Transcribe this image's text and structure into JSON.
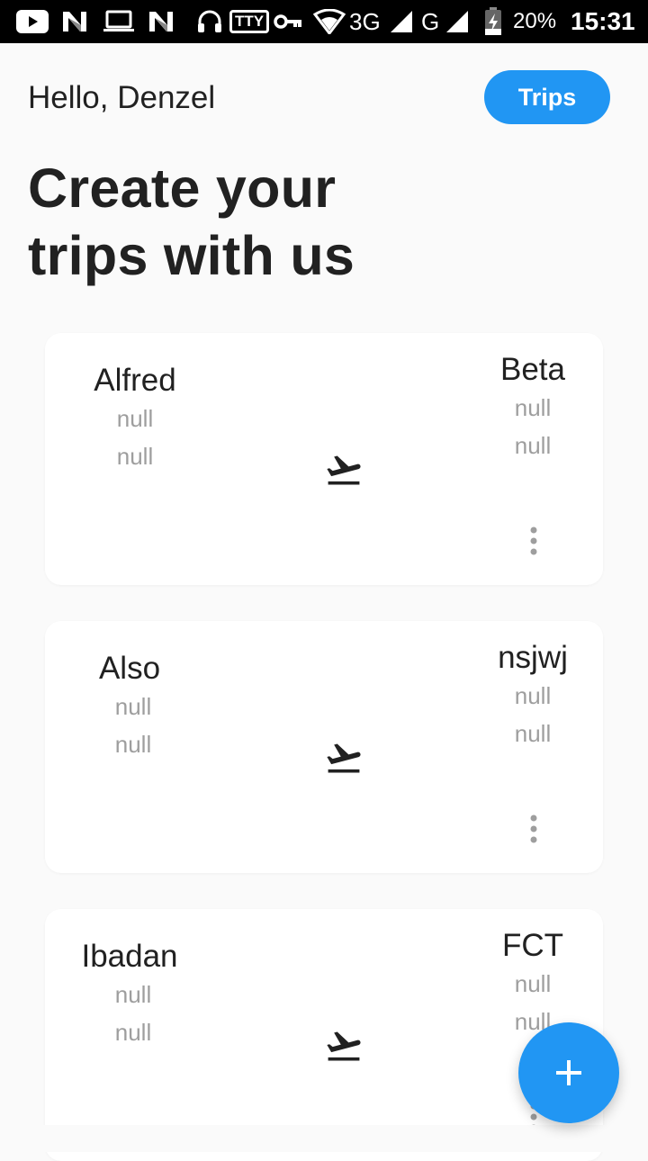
{
  "status_bar": {
    "tty_label": "TTY",
    "network_3g": "3G",
    "network_g": "G",
    "battery": "20%",
    "time": "15:31"
  },
  "header": {
    "greeting": "Hello, Denzel",
    "trips_button": "Trips",
    "headline_line1": "Create your",
    "headline_line2": "trips with us"
  },
  "trips": [
    {
      "origin": "Alfred",
      "origin_line1": "null",
      "origin_line2": "null",
      "destination": "Beta",
      "destination_line1": "null",
      "destination_line2": "null"
    },
    {
      "origin": "Also",
      "origin_line1": "null",
      "origin_line2": "null",
      "destination": "nsjwj",
      "destination_line1": "null",
      "destination_line2": "null"
    },
    {
      "origin": "Ibadan",
      "origin_line1": "null",
      "origin_line2": "null",
      "destination": "FCT",
      "destination_line1": "null",
      "destination_line2": "null"
    }
  ],
  "colors": {
    "accent": "#2196f3",
    "background": "#fafafa",
    "card": "#ffffff",
    "muted_text": "#9e9e9e"
  },
  "icons": {
    "plane": "flight-takeoff-icon",
    "more": "more-vert-icon",
    "fab": "add-icon"
  }
}
